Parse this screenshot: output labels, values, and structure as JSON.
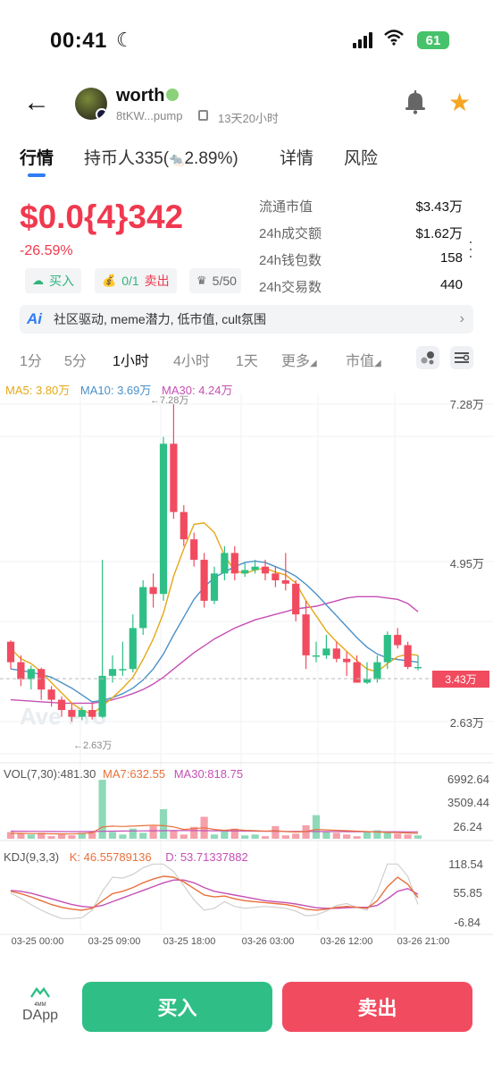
{
  "status_bar": {
    "time": "00:41",
    "battery": "61"
  },
  "header": {
    "token_name": "worth",
    "address": "8tKW...pump",
    "age": "13天20小时"
  },
  "tabs": [
    {
      "label": "行情"
    },
    {
      "label_prefix": "持币人335(",
      "label_suffix": "2.89%)"
    },
    {
      "label": "详情"
    },
    {
      "label": "风险"
    }
  ],
  "price": {
    "value": "$0.0{4}342",
    "change": "-26.59%"
  },
  "chips": {
    "buy": "买入",
    "sell_count": "0/1",
    "sell": "卖出",
    "holders": "5/50"
  },
  "stats": [
    {
      "k": "流通市值",
      "v": "$3.43万"
    },
    {
      "k": "24h成交额",
      "v": "$1.62万"
    },
    {
      "k": "24h钱包数",
      "v": "158"
    },
    {
      "k": "24h交易数",
      "v": "440"
    }
  ],
  "ai_summary": "社区驱动, meme潜力, 低市值, cult氛围",
  "timeframes": [
    "1分",
    "5分",
    "1小时",
    "4小时",
    "1天",
    "更多",
    "市值"
  ],
  "active_timeframe": "1小时",
  "colors": {
    "up": "#2fbf86",
    "down": "#f14b60",
    "ma5": "#e6a817",
    "ma10": "#4a90c8",
    "ma30": "#c64fb5",
    "accent": "#2f7df6"
  },
  "chart_data": {
    "type": "candlestick",
    "legend": {
      "ma5": "MA5: 3.80万",
      "ma10": "MA10: 3.69万",
      "ma30": "MA30: 4.24万"
    },
    "y_ticks": [
      "7.28万",
      "4.95万",
      "2.63万"
    ],
    "high_label": "←7.28万",
    "low_label": "←2.63万",
    "current_price_tag": "3.43万",
    "watermark": "Ave Pro",
    "ylim": [
      2.2,
      7.6
    ],
    "x_ticks": [
      "03-25 00:00",
      "03-25 09:00",
      "03-25 18:00",
      "03-26 03:00",
      "03-26 12:00",
      "03-26 21:00"
    ],
    "candles": [
      [
        3.8,
        3.5,
        3.82,
        3.4
      ],
      [
        3.5,
        3.25,
        3.6,
        3.15
      ],
      [
        3.25,
        3.4,
        3.45,
        3.1
      ],
      [
        3.4,
        3.1,
        3.42,
        2.95
      ],
      [
        3.1,
        2.95,
        3.15,
        2.85
      ],
      [
        2.95,
        2.8,
        3.0,
        2.7
      ],
      [
        2.8,
        2.7,
        2.9,
        2.63
      ],
      [
        2.7,
        2.8,
        2.85,
        2.65
      ],
      [
        2.8,
        2.7,
        2.9,
        2.66
      ],
      [
        2.7,
        3.3,
        5.0,
        2.68
      ],
      [
        3.3,
        3.4,
        3.6,
        3.2
      ],
      [
        3.4,
        3.4,
        3.8,
        3.3
      ],
      [
        3.4,
        4.0,
        4.2,
        3.35
      ],
      [
        4.0,
        4.6,
        4.7,
        3.9
      ],
      [
        4.6,
        4.5,
        4.8,
        4.3
      ],
      [
        4.5,
        6.7,
        6.8,
        4.4
      ],
      [
        6.7,
        5.7,
        7.28,
        5.6
      ],
      [
        5.7,
        5.3,
        5.8,
        5.2
      ],
      [
        5.3,
        5.0,
        5.4,
        4.9
      ],
      [
        5.0,
        4.4,
        5.1,
        4.3
      ],
      [
        4.4,
        4.8,
        4.9,
        4.35
      ],
      [
        4.8,
        5.1,
        5.2,
        4.7
      ],
      [
        5.1,
        4.8,
        5.2,
        4.7
      ],
      [
        4.8,
        4.85,
        4.95,
        4.75
      ],
      [
        4.85,
        4.9,
        5.0,
        4.8
      ],
      [
        4.9,
        4.8,
        5.0,
        4.7
      ],
      [
        4.8,
        4.7,
        4.9,
        4.6
      ],
      [
        4.7,
        4.65,
        5.1,
        4.55
      ],
      [
        4.65,
        4.2,
        4.7,
        4.1
      ],
      [
        4.2,
        3.6,
        4.4,
        3.4
      ],
      [
        3.6,
        3.6,
        3.8,
        3.5
      ],
      [
        3.6,
        3.7,
        3.9,
        3.55
      ],
      [
        3.7,
        3.55,
        3.8,
        3.5
      ],
      [
        3.55,
        3.5,
        3.65,
        3.3
      ],
      [
        3.5,
        3.2,
        3.6,
        3.2
      ],
      [
        3.2,
        3.25,
        3.5,
        3.18
      ],
      [
        3.25,
        3.5,
        3.6,
        3.2
      ],
      [
        3.5,
        3.9,
        3.95,
        3.4
      ],
      [
        3.9,
        3.75,
        4.0,
        3.7
      ],
      [
        3.75,
        3.43,
        3.8,
        3.4
      ],
      [
        3.43,
        3.43,
        3.6,
        3.38
      ]
    ],
    "ma5": [
      3.7,
      3.55,
      3.48,
      3.36,
      3.2,
      3.05,
      2.9,
      2.8,
      2.74,
      2.86,
      2.98,
      3.12,
      3.28,
      3.54,
      3.84,
      4.22,
      4.76,
      5.16,
      5.52,
      5.54,
      5.4,
      5.06,
      4.84,
      4.8,
      4.85,
      4.88,
      4.82,
      4.78,
      4.66,
      4.4,
      4.18,
      3.96,
      3.8,
      3.66,
      3.52,
      3.4,
      3.36,
      3.48,
      3.58,
      3.62,
      3.6
    ],
    "ma10": [
      3.4,
      3.38,
      3.35,
      3.32,
      3.28,
      3.2,
      3.12,
      3.02,
      2.92,
      2.94,
      2.98,
      3.04,
      3.12,
      3.24,
      3.4,
      3.62,
      3.9,
      4.16,
      4.42,
      4.6,
      4.74,
      4.82,
      4.9,
      4.96,
      4.98,
      4.96,
      4.9,
      4.84,
      4.76,
      4.64,
      4.5,
      4.34,
      4.18,
      4.02,
      3.86,
      3.72,
      3.62,
      3.56,
      3.54,
      3.52,
      3.5
    ],
    "ma30": [
      2.95,
      2.94,
      2.93,
      2.92,
      2.91,
      2.9,
      2.9,
      2.9,
      2.9,
      2.92,
      2.95,
      2.99,
      3.04,
      3.1,
      3.18,
      3.28,
      3.4,
      3.52,
      3.64,
      3.74,
      3.84,
      3.92,
      4.0,
      4.06,
      4.12,
      4.16,
      4.2,
      4.24,
      4.28,
      4.3,
      4.32,
      4.36,
      4.4,
      4.44,
      4.46,
      4.46,
      4.46,
      4.44,
      4.42,
      4.36,
      4.24
    ],
    "vol_legend": {
      "vol": "VOL(7,30):481.30",
      "ma7": "MA7:632.55",
      "ma30": "MA30:818.75"
    },
    "vol_ticks": [
      "6992.64",
      "3509.44",
      "26.24"
    ],
    "vol_ylim": [
      0,
      7000
    ],
    "volumes": [
      800,
      600,
      500,
      700,
      300,
      500,
      400,
      700,
      900,
      6992,
      800,
      500,
      1200,
      700,
      1500,
      3500,
      900,
      500,
      1400,
      2600,
      500,
      1000,
      1200,
      400,
      500,
      300,
      1500,
      400,
      600,
      1600,
      2800,
      900,
      700,
      500,
      300,
      900,
      1000,
      700,
      600,
      500,
      400
    ],
    "vol_ma7": [
      650,
      640,
      620,
      600,
      580,
      570,
      560,
      620,
      700,
      1400,
      1500,
      1450,
      1500,
      1550,
      1600,
      1550,
      1400,
      1100,
      1200,
      1300,
      1100,
      1000,
      1100,
      1000,
      950,
      900,
      950,
      850,
      800,
      850,
      1100,
      1050,
      1000,
      950,
      900,
      850,
      800,
      750,
      720,
      680,
      632
    ],
    "vol_ma30": [
      900,
      890,
      880,
      870,
      860,
      850,
      840,
      850,
      860,
      880,
      900,
      910,
      920,
      930,
      940,
      950,
      960,
      960,
      960,
      950,
      940,
      930,
      920,
      910,
      900,
      890,
      880,
      870,
      860,
      860,
      860,
      850,
      845,
      840,
      835,
      830,
      828,
      825,
      822,
      820,
      818
    ],
    "kdj_legend": {
      "kdj": "KDJ(9,3,3)",
      "k": "K: 46.55789136",
      "d": "D: 53.71337882"
    },
    "kdj_ticks": [
      "118.54",
      "55.85",
      "-6.84"
    ],
    "kdj_ylim": [
      -10,
      125
    ],
    "kdj_k": [
      60,
      55,
      48,
      40,
      32,
      26,
      22,
      20,
      24,
      40,
      55,
      60,
      68,
      78,
      86,
      92,
      90,
      80,
      66,
      52,
      48,
      50,
      44,
      40,
      38,
      36,
      34,
      32,
      28,
      22,
      20,
      22,
      26,
      28,
      26,
      24,
      40,
      70,
      90,
      75,
      46.56
    ],
    "kdj_d": [
      62,
      60,
      56,
      50,
      44,
      38,
      32,
      28,
      26,
      30,
      38,
      46,
      54,
      62,
      70,
      78,
      84,
      84,
      78,
      68,
      60,
      56,
      52,
      48,
      44,
      40,
      38,
      36,
      33,
      29,
      25,
      24,
      24,
      25,
      26,
      26,
      30,
      44,
      60,
      66,
      53.71
    ],
    "kdj_j": [
      56,
      45,
      32,
      20,
      10,
      2,
      2,
      4,
      20,
      60,
      90,
      88,
      96,
      110,
      118,
      118,
      102,
      72,
      42,
      20,
      24,
      38,
      28,
      24,
      26,
      28,
      26,
      24,
      18,
      8,
      10,
      18,
      30,
      34,
      26,
      20,
      60,
      118,
      118,
      92,
      32
    ]
  },
  "bottom": {
    "dapp_label": "DApp",
    "dapp_logo": "4MM",
    "buy": "买入",
    "sell": "卖出"
  }
}
